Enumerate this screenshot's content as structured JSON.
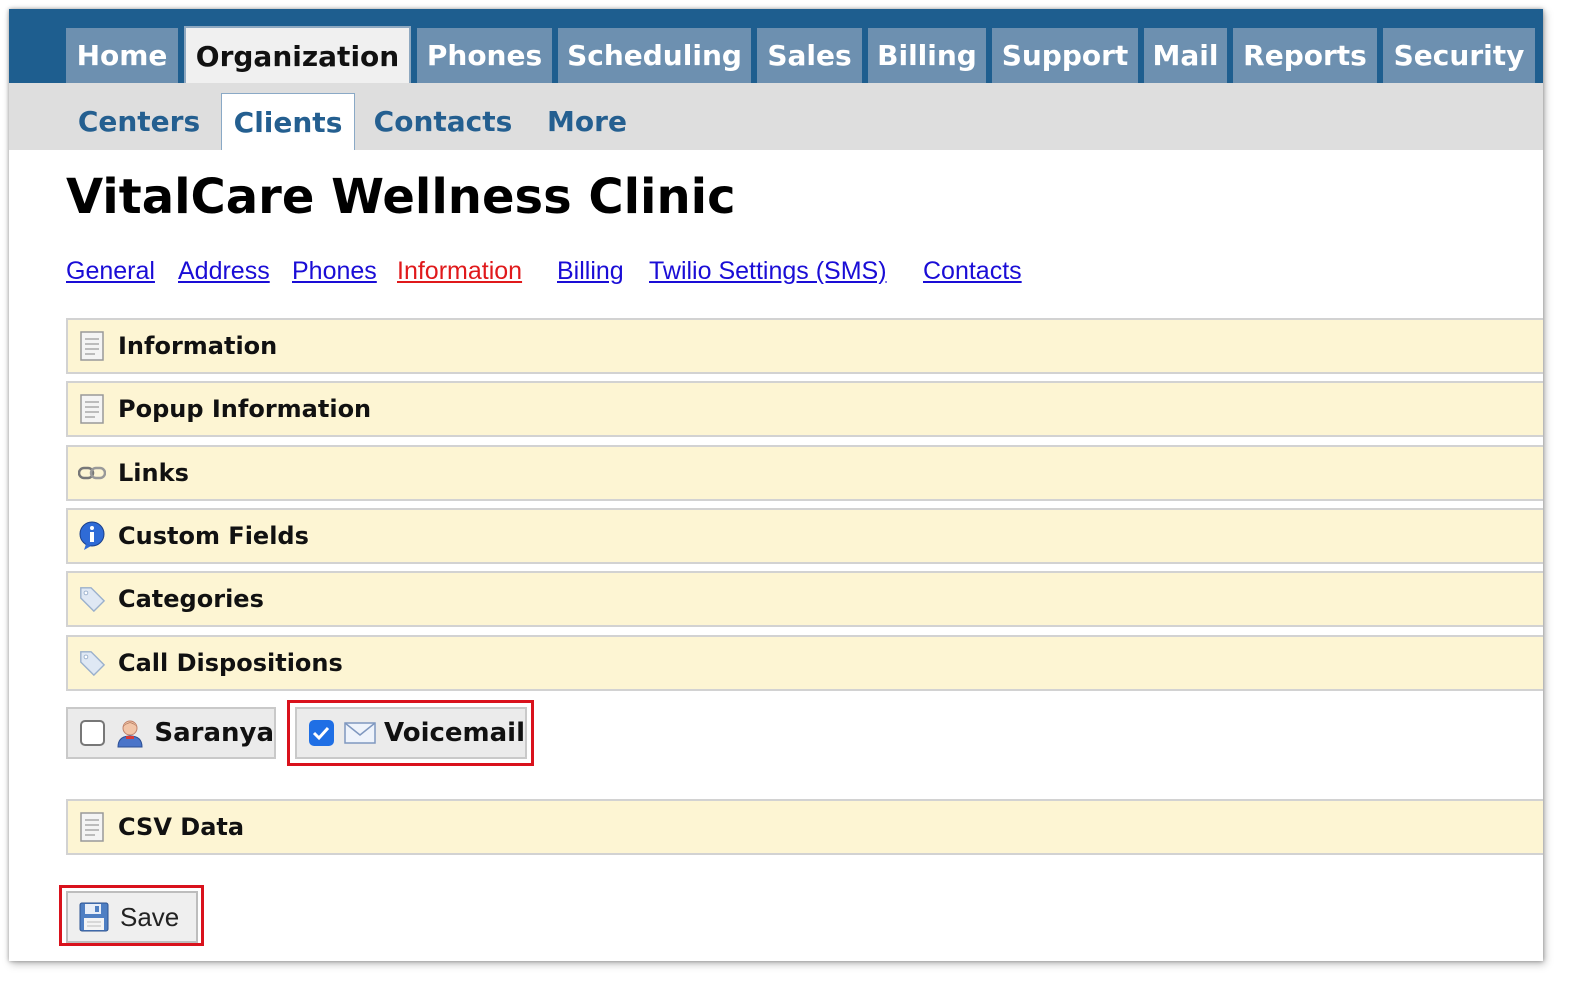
{
  "nav": {
    "top_tabs": [
      {
        "label": "Home"
      },
      {
        "label": "Organization",
        "active": true
      },
      {
        "label": "Phones"
      },
      {
        "label": "Scheduling"
      },
      {
        "label": "Sales"
      },
      {
        "label": "Billing"
      },
      {
        "label": "Support"
      },
      {
        "label": "Mail"
      },
      {
        "label": "Reports"
      },
      {
        "label": "Security"
      }
    ],
    "sub_tabs": [
      {
        "label": "Centers"
      },
      {
        "label": "Clients",
        "active": true
      },
      {
        "label": "Contacts"
      },
      {
        "label": "More"
      }
    ]
  },
  "page": {
    "title": "VitalCare Wellness Clinic",
    "links": [
      {
        "label": "General"
      },
      {
        "label": "Address"
      },
      {
        "label": "Phones"
      },
      {
        "label": "Information",
        "current": true
      },
      {
        "label": "Billing"
      },
      {
        "label": "Twilio Settings (SMS)"
      },
      {
        "label": "Contacts"
      }
    ]
  },
  "sections": [
    {
      "label": "Information",
      "icon": "document-icon"
    },
    {
      "label": "Popup Information",
      "icon": "document-icon"
    },
    {
      "label": "Links",
      "icon": "chain-link-icon"
    },
    {
      "label": "Custom Fields",
      "icon": "info-icon"
    },
    {
      "label": "Categories",
      "icon": "tag-icon"
    },
    {
      "label": "Call Dispositions",
      "icon": "tag-icon"
    },
    {
      "label": "CSV Data",
      "icon": "document-icon"
    }
  ],
  "dispositions": [
    {
      "label": "Saranya",
      "checked": false,
      "icon": "user-icon"
    },
    {
      "label": "Voicemail",
      "checked": true,
      "icon": "envelope-icon"
    }
  ],
  "actions": {
    "save_label": "Save",
    "save_icon": "floppy-disk-icon"
  },
  "colors": {
    "nav_bar": "#1e5e8f",
    "tab_bg": "#6d90b0",
    "section_bg": "#fdf5d3",
    "link": "#1a0dd6",
    "link_current": "#e0191b",
    "highlight": "#d9121c",
    "checkbox_checked": "#1f6fe5"
  }
}
